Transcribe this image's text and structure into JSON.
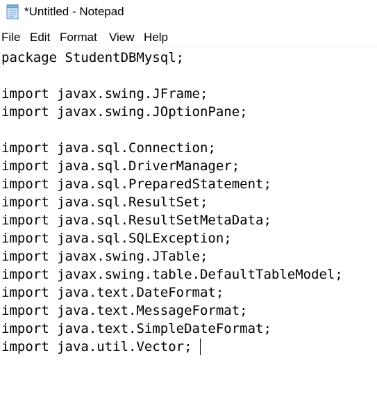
{
  "window": {
    "title": "*Untitled - Notepad",
    "icon": "notepad-icon"
  },
  "menu": {
    "items": [
      "File",
      "Edit",
      "Format",
      "View",
      "Help"
    ]
  },
  "editor": {
    "lines": [
      "package StudentDBMysql;",
      "",
      "import javax.swing.JFrame;",
      "import javax.swing.JOptionPane;",
      "",
      "import java.sql.Connection;",
      "import java.sql.DriverManager;",
      "import java.sql.PreparedStatement;",
      "import java.sql.ResultSet;",
      "import java.sql.ResultSetMetaData;",
      "import java.sql.SQLException;",
      "import javax.swing.JTable;",
      "import javax.swing.table.DefaultTableModel;",
      "import java.text.DateFormat;",
      "import java.text.MessageFormat;",
      "import java.text.SimpleDateFormat;",
      "import java.util.Vector;"
    ]
  }
}
